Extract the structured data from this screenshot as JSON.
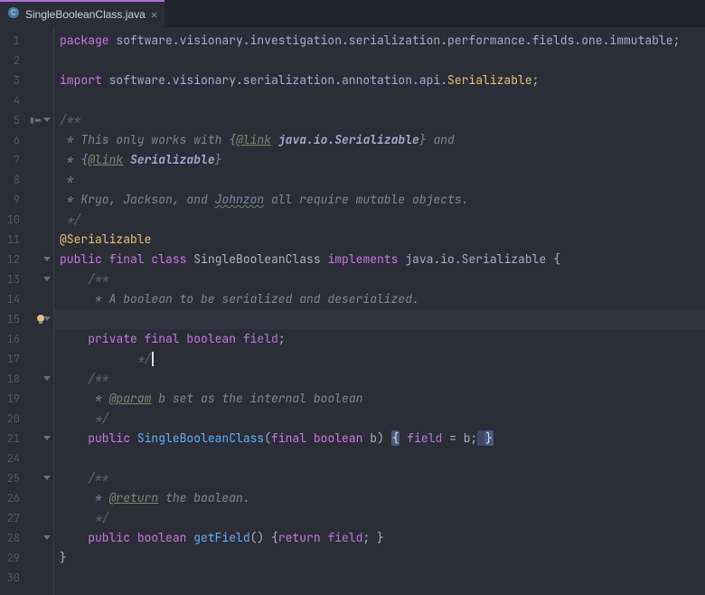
{
  "tab": {
    "name": "SingleBooleanClass.java"
  },
  "code": {
    "l1": {
      "kw1": "package ",
      "pkg": "software.visionary.investigation.serialization.performance.fields.one.immutable",
      "sc": ";"
    },
    "l3": {
      "kw1": "import ",
      "pkg": "software.visionary.serialization.annotation.api.",
      "cls": "Serializable",
      "sc": ";"
    },
    "l5": "/**",
    "l6a": " * This only works with {",
    "l6b": "@link",
    "l6c": " ",
    "l6d": "java.io.Serializable",
    "l6e": "} and",
    "l7a": " * {",
    "l7b": "@link",
    "l7c": " ",
    "l7d": "Serializable",
    "l7e": "}",
    "l8": " *",
    "l9a": " * Kryo, Jackson, and ",
    "l9b": "Johnzon",
    "l9c": " all require mutable objects.",
    "l10": " */",
    "l11": "@Serializable",
    "l12": {
      "kw1": "public ",
      "kw2": "final ",
      "kw3": "class ",
      "cls": "SingleBooleanClass ",
      "kw4": "implements ",
      "pkg": "java.io.Serializable ",
      "br": "{"
    },
    "l13": "    /**",
    "l14": "     * A boolean to be serialized and deserialized.",
    "l15": "     */",
    "l16": {
      "ind": "    ",
      "kw1": "private ",
      "kw2": "final ",
      "kw3": "boolean ",
      "fld": "field",
      "sc": ";"
    },
    "l18": "    /**",
    "l19a": "     * ",
    "l19b": "@param",
    "l19c": " b set as the internal boolean",
    "l20": "     */",
    "l21": {
      "ind": "    ",
      "kw1": "public ",
      "fn": "SingleBooleanClass",
      "p1": "(",
      "kw2": "final ",
      "kw3": "boolean ",
      "arg": "b",
      "p2": ") ",
      "br1": "{",
      "sp": " ",
      "fld": "field",
      "eq": " = ",
      "v": "b",
      "sc": ";",
      "sp2": " ",
      "br2": "}"
    },
    "l25": "    /**",
    "l26a": "     * ",
    "l26b": "@return",
    "l26c": " the boolean.",
    "l27": "     */",
    "l28": {
      "ind": "    ",
      "kw1": "public ",
      "kw2": "boolean ",
      "fn": "getField",
      "p1": "() {",
      "kw3": "return ",
      "fld": "field",
      "sc": "; }"
    },
    "l29": "}"
  },
  "lineNumbers": [
    "1",
    "2",
    "3",
    "4",
    "5",
    "6",
    "7",
    "8",
    "9",
    "10",
    "11",
    "12",
    "13",
    "14",
    "15",
    "16",
    "17",
    "18",
    "19",
    "20",
    "21",
    "24",
    "25",
    "26",
    "27",
    "28",
    "29",
    "30"
  ]
}
